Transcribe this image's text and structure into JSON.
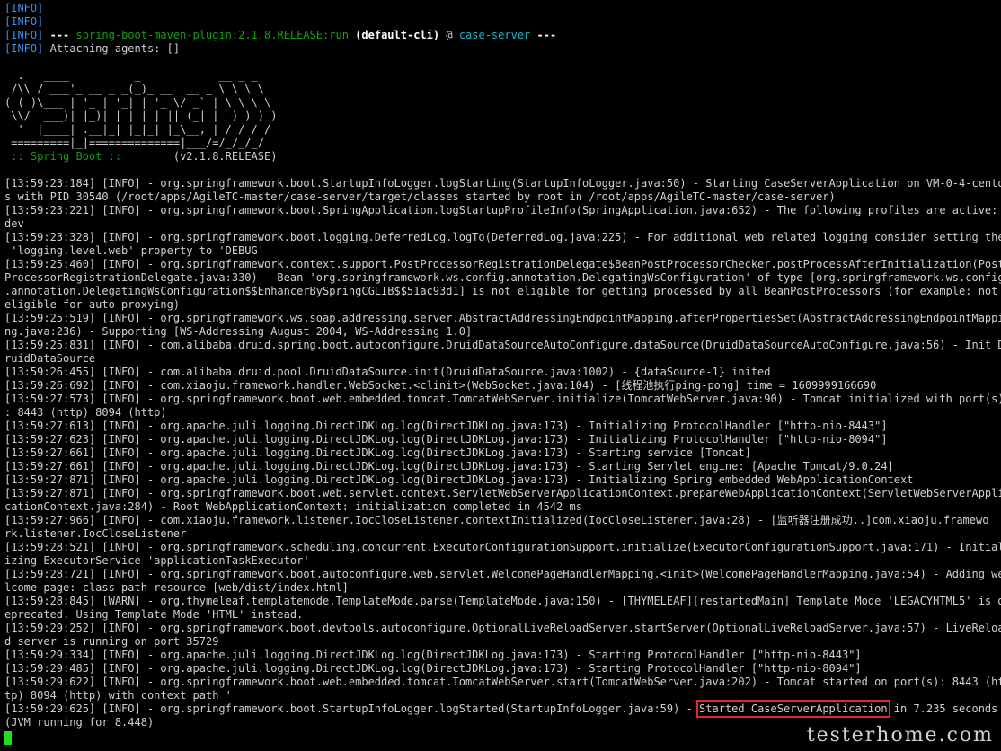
{
  "header": {
    "info_tag": "[INFO]",
    "plugin_name": "spring-boot-maven-plugin:2.1.8.RELEASE:run",
    "cli": "(default-cli)",
    "at": "@",
    "project": "case-server",
    "dashes_start": "---",
    "dashes_end": "---",
    "attaching": "Attaching agents: []"
  },
  "banner": {
    "lines": [
      "  .   ____          _            __ _ _",
      " /\\\\ / ___'_ __ _ _(_)_ __  __ _ \\ \\ \\ \\",
      "( ( )\\___ | '_ | '_| | '_ \\/ _` | \\ \\ \\ \\",
      " \\\\/  ___)| |_)| | | | | || (_| |  ) ) ) )",
      "  '  |____| .__|_| |_|_| |_\\__, | / / / /",
      " =========|_|==============|___/=/_/_/_/"
    ],
    "spring_label": " :: Spring Boot ::",
    "version": "        (v2.1.8.RELEASE)"
  },
  "log": [
    "[13:59:23:184] [INFO] - org.springframework.boot.StartupInfoLogger.logStarting(StartupInfoLogger.java:50) - Starting CaseServerApplication on VM-0-4-cento",
    "s with PID 30540 (/root/apps/AgileTC-master/case-server/target/classes started by root in /root/apps/AgileTC-master/case-server)",
    "[13:59:23:221] [INFO] - org.springframework.boot.SpringApplication.logStartupProfileInfo(SpringApplication.java:652) - The following profiles are active:",
    "dev",
    "[13:59:23:328] [INFO] - org.springframework.boot.logging.DeferredLog.logTo(DeferredLog.java:225) - For additional web related logging consider setting the",
    " 'logging.level.web' property to 'DEBUG'",
    "[13:59:25:460] [INFO] - org.springframework.context.support.PostProcessorRegistrationDelegate$BeanPostProcessorChecker.postProcessAfterInitialization(Post",
    "ProcessorRegistrationDelegate.java:330) - Bean 'org.springframework.ws.config.annotation.DelegatingWsConfiguration' of type [org.springframework.ws.config",
    ".annotation.DelegatingWsConfiguration$$EnhancerBySpringCGLIB$$51ac93d1] is not eligible for getting processed by all BeanPostProcessors (for example: not",
    "eligible for auto-proxying)",
    "[13:59:25:519] [INFO] - org.springframework.ws.soap.addressing.server.AbstractAddressingEndpointMapping.afterPropertiesSet(AbstractAddressingEndpointMappi",
    "ng.java:236) - Supporting [WS-Addressing August 2004, WS-Addressing 1.0]",
    "[13:59:25:831] [INFO] - com.alibaba.druid.spring.boot.autoconfigure.DruidDataSourceAutoConfigure.dataSource(DruidDataSourceAutoConfigure.java:56) - Init D",
    "ruidDataSource",
    "[13:59:26:455] [INFO] - com.alibaba.druid.pool.DruidDataSource.init(DruidDataSource.java:1002) - {dataSource-1} inited",
    "[13:59:26:692] [INFO] - com.xiaoju.framework.handler.WebSocket.<clinit>(WebSocket.java:104) - [线程池执行ping-pong] time = 1609999166690",
    "[13:59:27:573] [INFO] - org.springframework.boot.web.embedded.tomcat.TomcatWebServer.initialize(TomcatWebServer.java:90) - Tomcat initialized with port(s)",
    ": 8443 (http) 8094 (http)",
    "[13:59:27:613] [INFO] - org.apache.juli.logging.DirectJDKLog.log(DirectJDKLog.java:173) - Initializing ProtocolHandler [\"http-nio-8443\"]",
    "[13:59:27:623] [INFO] - org.apache.juli.logging.DirectJDKLog.log(DirectJDKLog.java:173) - Initializing ProtocolHandler [\"http-nio-8094\"]",
    "[13:59:27:661] [INFO] - org.apache.juli.logging.DirectJDKLog.log(DirectJDKLog.java:173) - Starting service [Tomcat]",
    "[13:59:27:661] [INFO] - org.apache.juli.logging.DirectJDKLog.log(DirectJDKLog.java:173) - Starting Servlet engine: [Apache Tomcat/9.0.24]",
    "[13:59:27:871] [INFO] - org.apache.juli.logging.DirectJDKLog.log(DirectJDKLog.java:173) - Initializing Spring embedded WebApplicationContext",
    "[13:59:27:871] [INFO] - org.springframework.boot.web.servlet.context.ServletWebServerApplicationContext.prepareWebApplicationContext(ServletWebServerAppli",
    "cationContext.java:284) - Root WebApplicationContext: initialization completed in 4542 ms",
    "[13:59:27:966] [INFO] - com.xiaoju.framework.listener.IocCloseListener.contextInitialized(IocCloseListener.java:28) - [监听器注册成功..]com.xiaoju.framewo",
    "rk.listener.IocCloseListener",
    "[13:59:28:521] [INFO] - org.springframework.scheduling.concurrent.ExecutorConfigurationSupport.initialize(ExecutorConfigurationSupport.java:171) - Initial",
    "izing ExecutorService 'applicationTaskExecutor'",
    "[13:59:28:721] [INFO] - org.springframework.boot.autoconfigure.web.servlet.WelcomePageHandlerMapping.<init>(WelcomePageHandlerMapping.java:54) - Adding we",
    "lcome page: class path resource [web/dist/index.html]",
    "[13:59:28:845] [WARN] - org.thymeleaf.templatemode.TemplateMode.parse(TemplateMode.java:150) - [THYMELEAF][restartedMain] Template Mode 'LEGACYHTML5' is d",
    "eprecated. Using Template Mode 'HTML' instead.",
    "[13:59:29:252] [INFO] - org.springframework.boot.devtools.autoconfigure.OptionalLiveReloadServer.startServer(OptionalLiveReloadServer.java:57) - LiveReloa",
    "d server is running on port 35729",
    "[13:59:29:334] [INFO] - org.apache.juli.logging.DirectJDKLog.log(DirectJDKLog.java:173) - Starting ProtocolHandler [\"http-nio-8443\"]",
    "[13:59:29:485] [INFO] - org.apache.juli.logging.DirectJDKLog.log(DirectJDKLog.java:173) - Starting ProtocolHandler [\"http-nio-8094\"]",
    "[13:59:29:622] [INFO] - org.springframework.boot.web.embedded.tomcat.TomcatWebServer.start(TomcatWebServer.java:202) - Tomcat started on port(s): 8443 (ht",
    "tp) 8094 (http) with context path ''"
  ],
  "final": {
    "prefix": "[13:59:29:625] [INFO] - org.springframework.boot.StartupInfoLogger.logStarted(StartupInfoLogger.java:59) - ",
    "highlight": "Started CaseServerApplication",
    "suffix": " in 7.235 seconds",
    "line2": "(JVM running for 8.448)"
  },
  "watermark": "testerhome.com",
  "colors": {
    "info": "#3b8eea",
    "green": "#12a012",
    "cyan": "#20b2c8",
    "highlight_box": "#e8262b",
    "cursor": "#22dd22"
  }
}
